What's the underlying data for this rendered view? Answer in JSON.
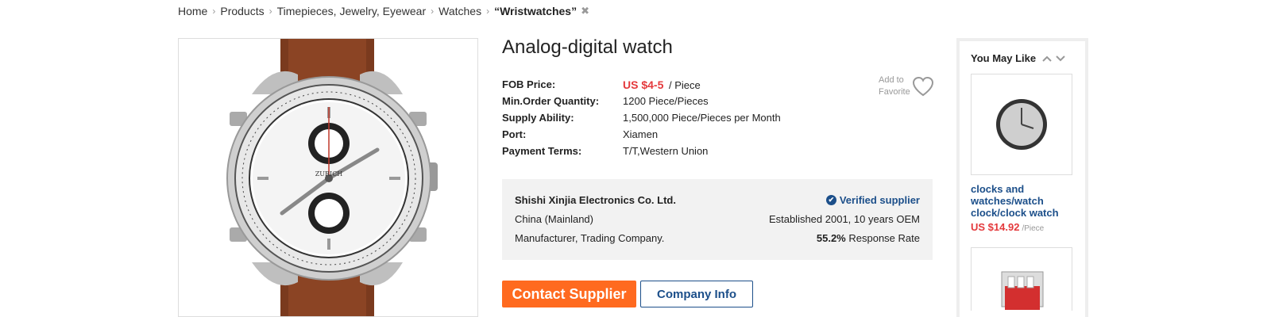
{
  "breadcrumb": {
    "items": [
      "Home",
      "Products",
      "Timepieces, Jewelry, Eyewear",
      "Watches"
    ],
    "current": "“Wristwatches”"
  },
  "product": {
    "title": "Analog-digital watch",
    "attributes": {
      "fob_label": "FOB Price:",
      "fob_price": "US $4-5",
      "fob_unit": "/ Piece",
      "moq_label": "Min.Order Quantity:",
      "moq_value": "1200 Piece/Pieces",
      "supply_label": "Supply Ability:",
      "supply_value": "1,500,000 Piece/Pieces per Month",
      "port_label": "Port:",
      "port_value": "Xiamen",
      "payment_label": "Payment Terms:",
      "payment_value": "T/T,Western Union"
    },
    "favorite_line1": "Add to",
    "favorite_line2": "Favorite"
  },
  "supplier": {
    "name": "Shishi Xinjia Electronics Co. Ltd.",
    "verified": "Verified supplier",
    "location": "China (Mainland)",
    "established": "Established 2001, 10 years OEM",
    "type": "Manufacturer, Trading Company.",
    "response_pct": "55.2%",
    "response_label": "Response Rate"
  },
  "buttons": {
    "contact": "Contact Supplier",
    "company": "Company Info"
  },
  "you_may_like": {
    "heading": "You May Like",
    "item": {
      "title": "clocks and watches/watch clock/clock watch",
      "price": "US $14.92",
      "unit": "/Piece"
    }
  },
  "colors": {
    "price_red": "#e4393c",
    "accent_orange": "#ff6a1f",
    "link_blue": "#1c4f8a",
    "watch_strap": "#7a3a1e"
  },
  "icons": [
    "breadcrumb-chevron-icon",
    "close-icon",
    "heart-icon",
    "verified-check-icon",
    "chevron-up-icon",
    "chevron-down-icon"
  ]
}
